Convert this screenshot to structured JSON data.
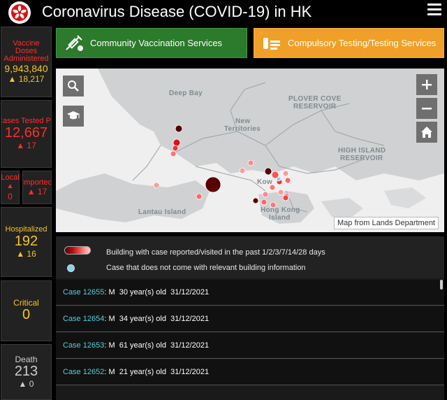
{
  "header": {
    "title": "Coronavirus Disease (COVID-19) in HK"
  },
  "stats": {
    "vaccine": {
      "label_line1": "Vaccine Doses",
      "label_line2": "Administered",
      "value": "9,943,840",
      "change": "▲ 18,217"
    },
    "cases_tested": {
      "label": "Cases Tested Po",
      "value": "12,667",
      "change": "▲ 17"
    },
    "local": {
      "label": "Local",
      "change_arrow": "▲",
      "value": "0"
    },
    "imported": {
      "label": "Imported",
      "change": "▲ 17"
    },
    "hospitalized": {
      "label": "Hospitalized",
      "value": "192",
      "change": "▲ 16"
    },
    "critical": {
      "label": "Critical",
      "value": "0"
    },
    "death": {
      "label": "Death",
      "value": "213",
      "change": "▲ 0"
    }
  },
  "buttons": {
    "vaccination": "Community Vaccination Services",
    "testing": "Compulsory Testing/Testing Services"
  },
  "map": {
    "labels": {
      "deep_bay": "Deep Bay",
      "plover_1": "PLOVER COVE",
      "plover_2": "RESERVOIR",
      "nt_1": "New",
      "nt_2": "Territories",
      "hi_1": "HIGH ISLAND",
      "hi_2": "RESERVOIR",
      "kowloon": "Kow",
      "lantau": "Lantau Island",
      "hk_1": "Hong Kong",
      "hk_2": "Island"
    },
    "attribution": "Map from Lands Department",
    "icons": [
      "search-icon",
      "graduation-cap-icon",
      "zoom-in-icon",
      "zoom-out-icon",
      "home-icon"
    ]
  },
  "legend": {
    "buildings": "Building with case reported/visited in the past 1/2/3/7/14/28 days",
    "no_building": "Case that does not come with relevant building information"
  },
  "cases": [
    {
      "id": "Case 12655",
      "details": ": M  30 year(s) old  31/12/2021"
    },
    {
      "id": "Case 12654",
      "details": ": M  34 year(s) old  31/12/2021"
    },
    {
      "id": "Case 12653",
      "details": ": M  61 year(s) old  31/12/2021"
    },
    {
      "id": "Case 12652",
      "details": ": M  21 year(s) old  31/12/2021"
    }
  ],
  "colors": {
    "accent_red": "#ff2d2d",
    "accent_yellow": "#f5c61d",
    "green_button": "#2c7a2c",
    "orange_button": "#f0a028",
    "case_id": "#4fd0d8"
  }
}
